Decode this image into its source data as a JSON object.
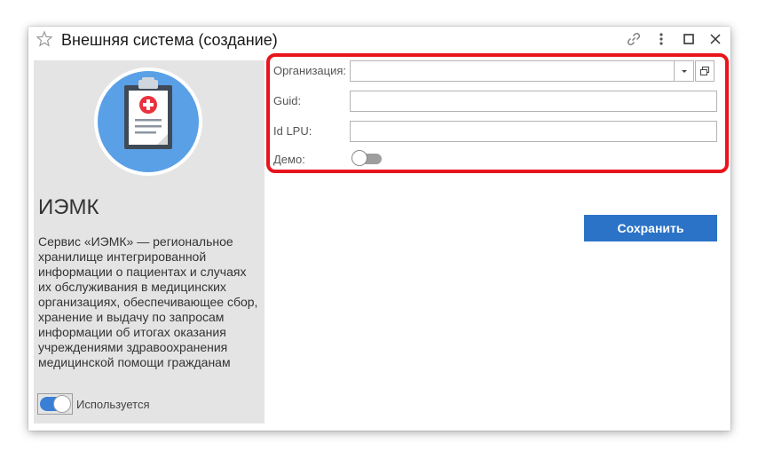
{
  "window": {
    "title": "Внешняя система (создание)"
  },
  "left_panel": {
    "app_name": "ИЭМК",
    "description": "Сервис «ИЭМК» — региональное хранилище интегрированной информации о пациентах и случаях их обслуживания в медицинских организациях, обеспечивающее сбор, хранение и выдачу по запросам информации об итогах оказания учреждениями здравоохранения медицинской помощи гражданам",
    "used_label": "Используется",
    "used_enabled": true
  },
  "form": {
    "organization": {
      "label": "Организация:",
      "value": ""
    },
    "guid": {
      "label": "Guid:",
      "value": ""
    },
    "id_lpu": {
      "label": "Id LPU:",
      "value": ""
    },
    "demo": {
      "label": "Демо:",
      "enabled": false
    }
  },
  "actions": {
    "save_label": "Сохранить"
  },
  "colors": {
    "accent": "#2b73c7",
    "highlight": "#e8141c",
    "panel_bg": "#e4e4e4",
    "logo_circle": "#5aa0e6"
  },
  "icons": {
    "favorite": "star-icon",
    "link": "link-icon",
    "more": "more-vertical-icon",
    "maximize": "maximize-icon",
    "close": "close-icon",
    "logo": "clipboard-medical-icon"
  }
}
